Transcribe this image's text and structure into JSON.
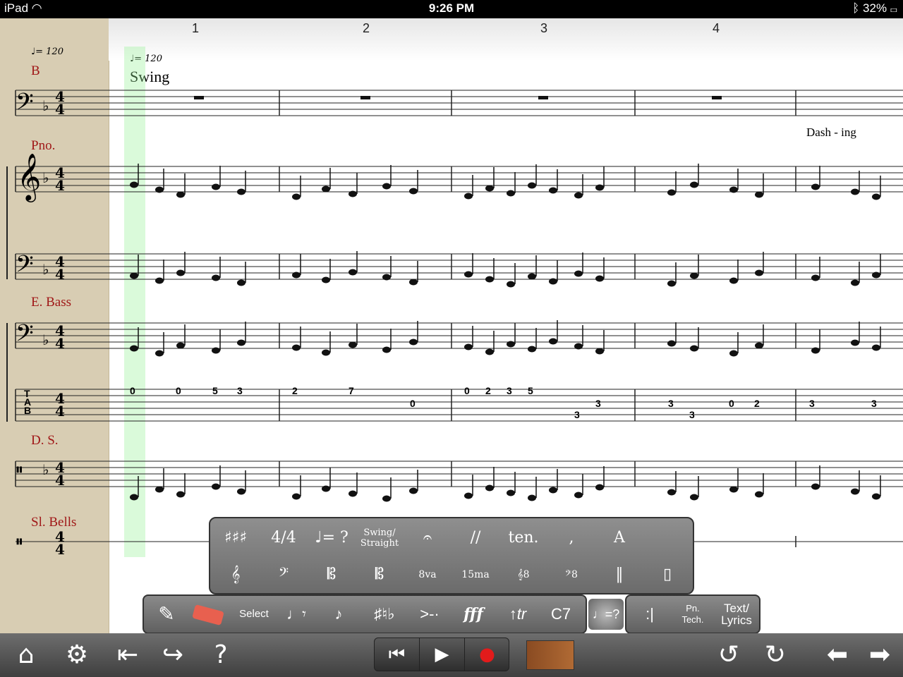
{
  "status": {
    "device": "iPad",
    "time": "9:26 PM",
    "battery": "32%",
    "wifi_icon": "wifi-icon",
    "bluetooth_icon": "bluetooth-icon"
  },
  "score": {
    "measure_numbers": [
      "1",
      "2",
      "3",
      "4"
    ],
    "gutter_tempo": "= 120",
    "tempo": "= 120",
    "style_text": "Swing",
    "instruments": [
      "B",
      "Pno.",
      "E. Bass",
      "D. S.",
      "Sl. Bells"
    ],
    "lyrics": "Dash - ing",
    "tab_label": "T\nA\nB",
    "tab_numbers": {
      "m1": [
        "0",
        "0",
        "5",
        "3"
      ],
      "m2": [
        "2",
        "7",
        "0"
      ],
      "m3": [
        "0",
        "2",
        "3",
        "5",
        "3",
        "3"
      ],
      "m4": [
        "3",
        "3",
        "0",
        "2"
      ],
      "m5": [
        "3",
        "3"
      ]
    }
  },
  "palette": {
    "row1": [
      "♯♯♯",
      "4/4",
      "♩= ?",
      "Swing/ Straight",
      "𝄐",
      "//",
      "ten.",
      ",",
      "A"
    ],
    "row2": [
      "𝄞",
      "𝄢",
      "𝄡",
      "𝄡",
      "8va",
      "15ma",
      "𝄞8",
      "𝄢8",
      "‖",
      "▯"
    ]
  },
  "toolbar": {
    "pencil_icon": "pencil-icon",
    "eraser_icon": "eraser-icon",
    "select_label": "Select",
    "note_rest": "♩𝄾",
    "tuplet": "♪",
    "accidentals": "♯♮♭",
    "articulations": ">-·",
    "dynamics": "fff",
    "trill": "↑tr",
    "chord": "C7",
    "tempo_button": "♩=?",
    "repeat_label": ":|",
    "pn_tech_label": "Pn. Tech.",
    "text_lyrics_label": "Text/ Lyrics"
  },
  "bottombar": {
    "home_icon": "home-icon",
    "gear_icon": "gear-icon",
    "import_icon": "import-icon",
    "share_icon": "share-icon",
    "help_icon": "help-icon",
    "rewind_icon": "rewind-icon",
    "play_icon": "play-icon",
    "record_icon": "record-icon",
    "fretboard_icon": "fretboard-icon",
    "undo_icon": "undo-icon",
    "redo_icon": "redo-icon",
    "prev_icon": "left-arrow-icon",
    "next_icon": "right-arrow-icon"
  }
}
